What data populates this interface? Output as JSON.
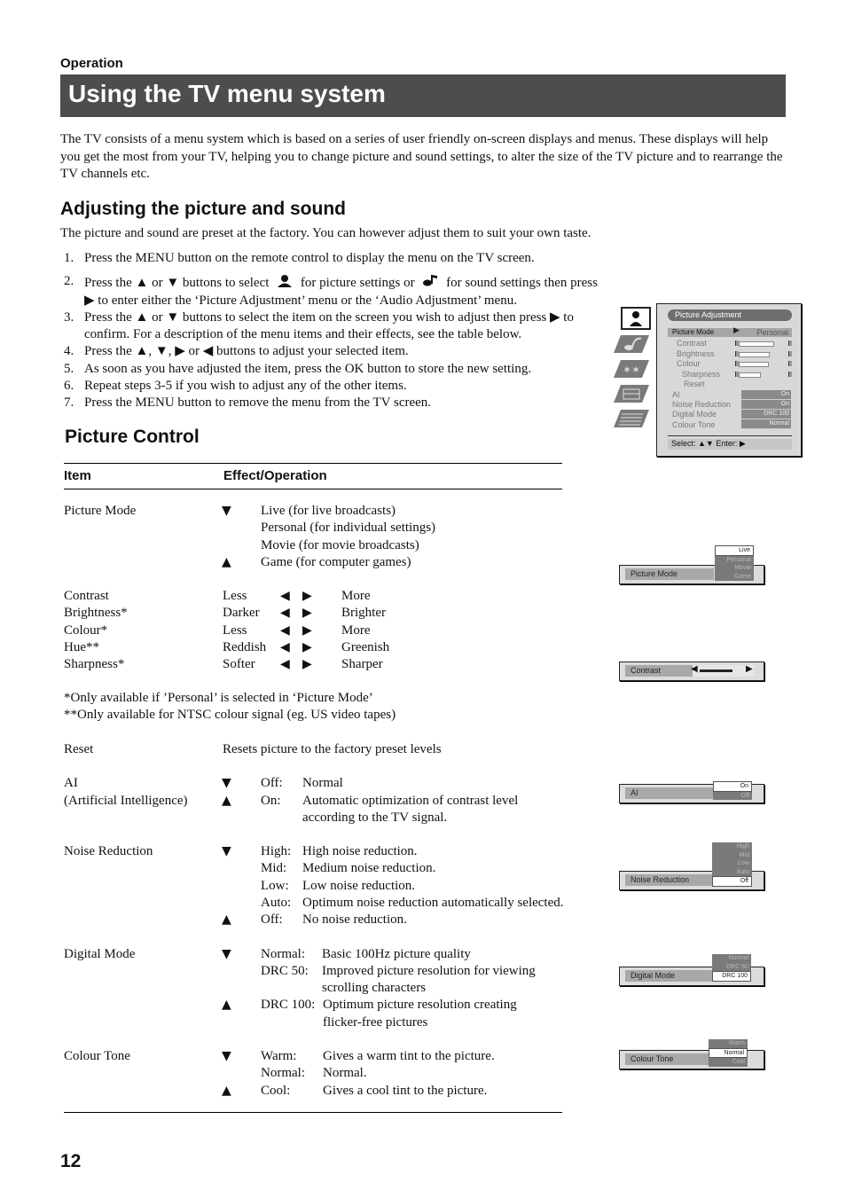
{
  "header": {
    "section": "Operation",
    "title": "Using the TV menu system",
    "title_bg": "#4d4d4d"
  },
  "intro": "The TV consists of a menu system which is based on a series of user friendly on-screen displays and menus. These displays will help you get the most from your TV, helping you to change picture and sound settings, to alter the size of the TV picture and to rearrange the TV channels etc.",
  "adjust": {
    "heading": "Adjusting the picture and sound",
    "lead": "The picture and sound are preset at the factory. You can however adjust them to suit your own taste.",
    "steps": [
      {
        "num": "1.",
        "text": "Press the MENU button on the remote control to display the menu on the TV screen."
      },
      {
        "num": "2.",
        "a": "Press the ▲ or ▼ buttons to select",
        "b": "for picture settings or",
        "c": "for sound settings then press ▶ to enter either the ‘Picture Adjustment’ menu or the ‘Audio Adjustment’ menu."
      },
      {
        "num": "3.",
        "text": "Press the ▲ or ▼ buttons to select the item on the screen you wish to adjust then press ▶ to confirm. For a description of the menu items and their effects, see the table below."
      },
      {
        "num": "4.",
        "text": "Press the ▲, ▼, ▶ or ◀ buttons to adjust your selected item."
      },
      {
        "num": "5.",
        "text": "As soon as you have adjusted the item, press the OK button to store the new setting."
      },
      {
        "num": "6.",
        "text": "Repeat steps 3-5 if you wish to adjust any of the other items."
      },
      {
        "num": "7.",
        "text": "Press the MENU button to remove the menu from the TV screen."
      }
    ],
    "icons": {
      "picture": "person-icon",
      "sound": "note-icon"
    }
  },
  "osd": {
    "title": "Picture Adjustment",
    "tabs": [
      "picture-icon",
      "sound-icon",
      "features-icon",
      "setup-icon",
      "teletext-icon"
    ],
    "picture_mode": {
      "label": "Picture Mode",
      "arrow": "▶",
      "value": "Personal"
    },
    "sliders": [
      {
        "label": "Contrast",
        "level": 0.95
      },
      {
        "label": "Brightness",
        "level": 0.82
      },
      {
        "label": "Colour",
        "level": 0.8
      },
      {
        "label": "Sharpness",
        "level": 0.58
      }
    ],
    "reset": "Reset",
    "options": [
      {
        "label": "AI",
        "value": "On"
      },
      {
        "label": "Noise Reduction",
        "value": "On"
      },
      {
        "label": "Digital Mode",
        "value": "DRC 100"
      },
      {
        "label": "Colour Tone",
        "value": "Normal"
      }
    ],
    "footer": "Select: ▲▼ Enter: ▶"
  },
  "picture_control": {
    "heading": "Picture Control",
    "col_item": "Item",
    "col_effect": "Effect/Operation",
    "picture_mode": {
      "item": "Picture Mode",
      "lines": [
        "Live  (for live broadcasts)",
        "Personal  (for individual settings)",
        "Movie  (for movie broadcasts)",
        "Game  (for computer games)"
      ]
    },
    "adjust_rows": [
      {
        "item": "Contrast",
        "low": "Less",
        "high": "More"
      },
      {
        "item": "Brightness*",
        "low": "Darker",
        "high": "Brighter"
      },
      {
        "item": "Colour*",
        "low": "Less",
        "high": "More"
      },
      {
        "item": "Hue**",
        "low": "Reddish",
        "high": "Greenish"
      },
      {
        "item": "Sharpness*",
        "low": "Softer",
        "high": "Sharper"
      }
    ],
    "note1": "*Only available if ’Personal’ is selected in ‘Picture Mode’",
    "note2": "**Only available for NTSC colour signal (eg. US video tapes)",
    "reset": {
      "item": "Reset",
      "effect": "Resets picture to the factory preset levels"
    },
    "ai": {
      "item": "AI",
      "item2": "(Artificial Intelligence)",
      "off_key": "Off:",
      "off_val": "Normal",
      "on_key": "On:",
      "on_val": "Automatic optimization of contrast level",
      "on_val2": "according to the TV signal."
    },
    "noise": {
      "item": "Noise Reduction",
      "rows": [
        {
          "k": "High:",
          "v": "High noise reduction."
        },
        {
          "k": "Mid:",
          "v": "Medium noise reduction."
        },
        {
          "k": "Low:",
          "v": "Low noise reduction."
        },
        {
          "k": "Auto:",
          "v": "Optimum noise reduction automatically selected."
        },
        {
          "k": "Off:",
          "v": "No noise reduction."
        }
      ]
    },
    "digital": {
      "item": "Digital Mode",
      "rows": [
        {
          "k": "Normal:",
          "v": "Basic 100Hz picture quality"
        },
        {
          "k": "DRC 50:",
          "v": "Improved picture resolution for viewing",
          "v2": "scrolling characters"
        },
        {
          "k": "DRC 100:",
          "v": "Optimum picture resolution creating",
          "v2": "flicker-free pictures"
        }
      ]
    },
    "tone": {
      "item": "Colour Tone",
      "rows": [
        {
          "k": "Warm:",
          "v": "Gives a warm tint to the picture."
        },
        {
          "k": "Normal:",
          "v": "Normal."
        },
        {
          "k": "Cool:",
          "v": "Gives a cool tint to the picture."
        }
      ]
    },
    "arrows": {
      "down": "▼",
      "up": "▲",
      "left": "◀",
      "right": "▶"
    }
  },
  "strips": {
    "picture_mode": {
      "label": "Picture Mode",
      "options": [
        "Live",
        "Personal",
        "Movie",
        "Game"
      ],
      "selected": "Live"
    },
    "contrast": {
      "label": "Contrast",
      "level": 0.85
    },
    "ai": {
      "label": "AI",
      "options": [
        "On",
        "Off"
      ],
      "selected": "On"
    },
    "noise": {
      "label": "Noise Reduction",
      "options": [
        "High",
        "Mid",
        "Low",
        "Auto",
        "Off"
      ],
      "selected": "Off"
    },
    "digital": {
      "label": "Digital Mode",
      "options": [
        "Normal",
        "DRC 50",
        "DRC 100"
      ],
      "selected": "DRC 100"
    },
    "tone": {
      "label": "Colour Tone",
      "options": [
        "Warm",
        "Normal",
        "Cool"
      ],
      "selected": "Normal"
    }
  },
  "page_number": "12"
}
